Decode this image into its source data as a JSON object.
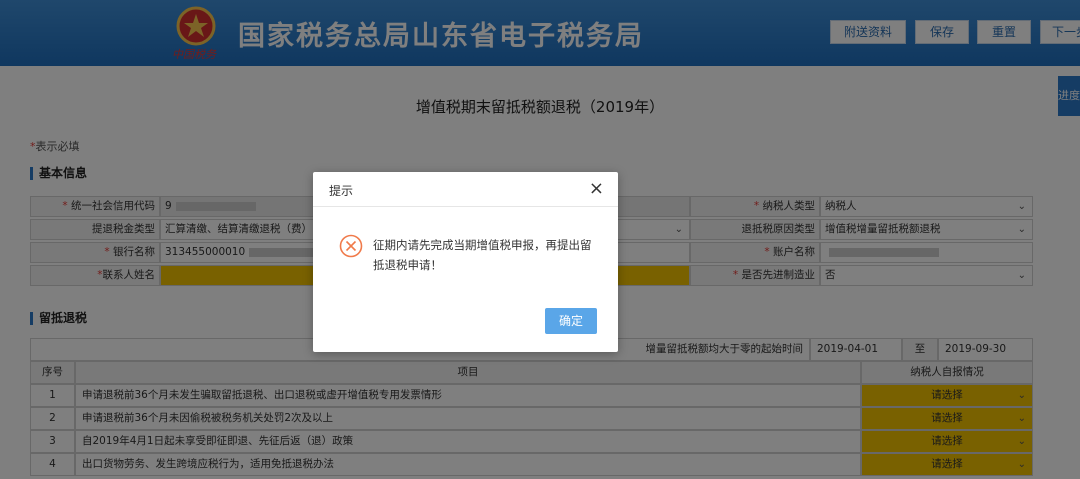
{
  "header": {
    "title": "国家税务总局山东省电子税务局",
    "emblem_caption": "中国税务",
    "buttons": [
      "附送资料",
      "保存",
      "重置",
      "下一步"
    ]
  },
  "side_tab": "进度",
  "page_title": "增值税期末留抵税额退税（2019年）",
  "required_note": "表示必填",
  "basic_info": {
    "section_title": "基本信息",
    "rows": [
      {
        "label_left": "统一社会信用代码",
        "value_left": "9",
        "label_right": "纳税人类型",
        "value_right": "纳税人"
      },
      {
        "label_left": "提退税金类型",
        "value_left": "汇算清缴、结算清缴退税（费）",
        "label_right": "退抵税原因类型",
        "value_right": "增值税增量留抵税额退税"
      },
      {
        "label_left": "银行名称",
        "value_left": "313455000010",
        "label_right": "账户名称",
        "value_right": ""
      },
      {
        "label_left": "联系人姓名",
        "value_left": "",
        "label_right": "是否先进制造业",
        "value_right": "否"
      }
    ]
  },
  "retention": {
    "section_title": "留抵退税",
    "period_label": "增量留抵税额均大于零的起始时间",
    "period_start": "2019-04-01",
    "period_to": "至",
    "period_end": "2019-09-30",
    "col_no": "序号",
    "col_item": "项目",
    "col_self": "纳税人自报情况",
    "rows": [
      {
        "no": "1",
        "item": "申请退税前36个月未发生骗取留抵退税、出口退税或虚开增值税专用发票情形",
        "choice": "请选择"
      },
      {
        "no": "2",
        "item": "申请退税前36个月未因偷税被税务机关处罚2次及以上",
        "choice": "请选择"
      },
      {
        "no": "3",
        "item": "自2019年4月1日起未享受即征即退、先征后返（退）政策",
        "choice": "请选择"
      },
      {
        "no": "4",
        "item": "出口货物劳务、发生跨境应税行为，适用免抵退税办法",
        "choice": "请选择"
      }
    ]
  },
  "dialog": {
    "title": "提示",
    "message": "征期内请先完成当期增值税申报，再提出留抵退税申请！",
    "confirm": "确定"
  },
  "colors": {
    "header_blue": "#1f6fbf",
    "accent_yellow": "#f2c200",
    "error_icon": "#f07a4a",
    "confirm_btn": "#5aa6e8"
  }
}
